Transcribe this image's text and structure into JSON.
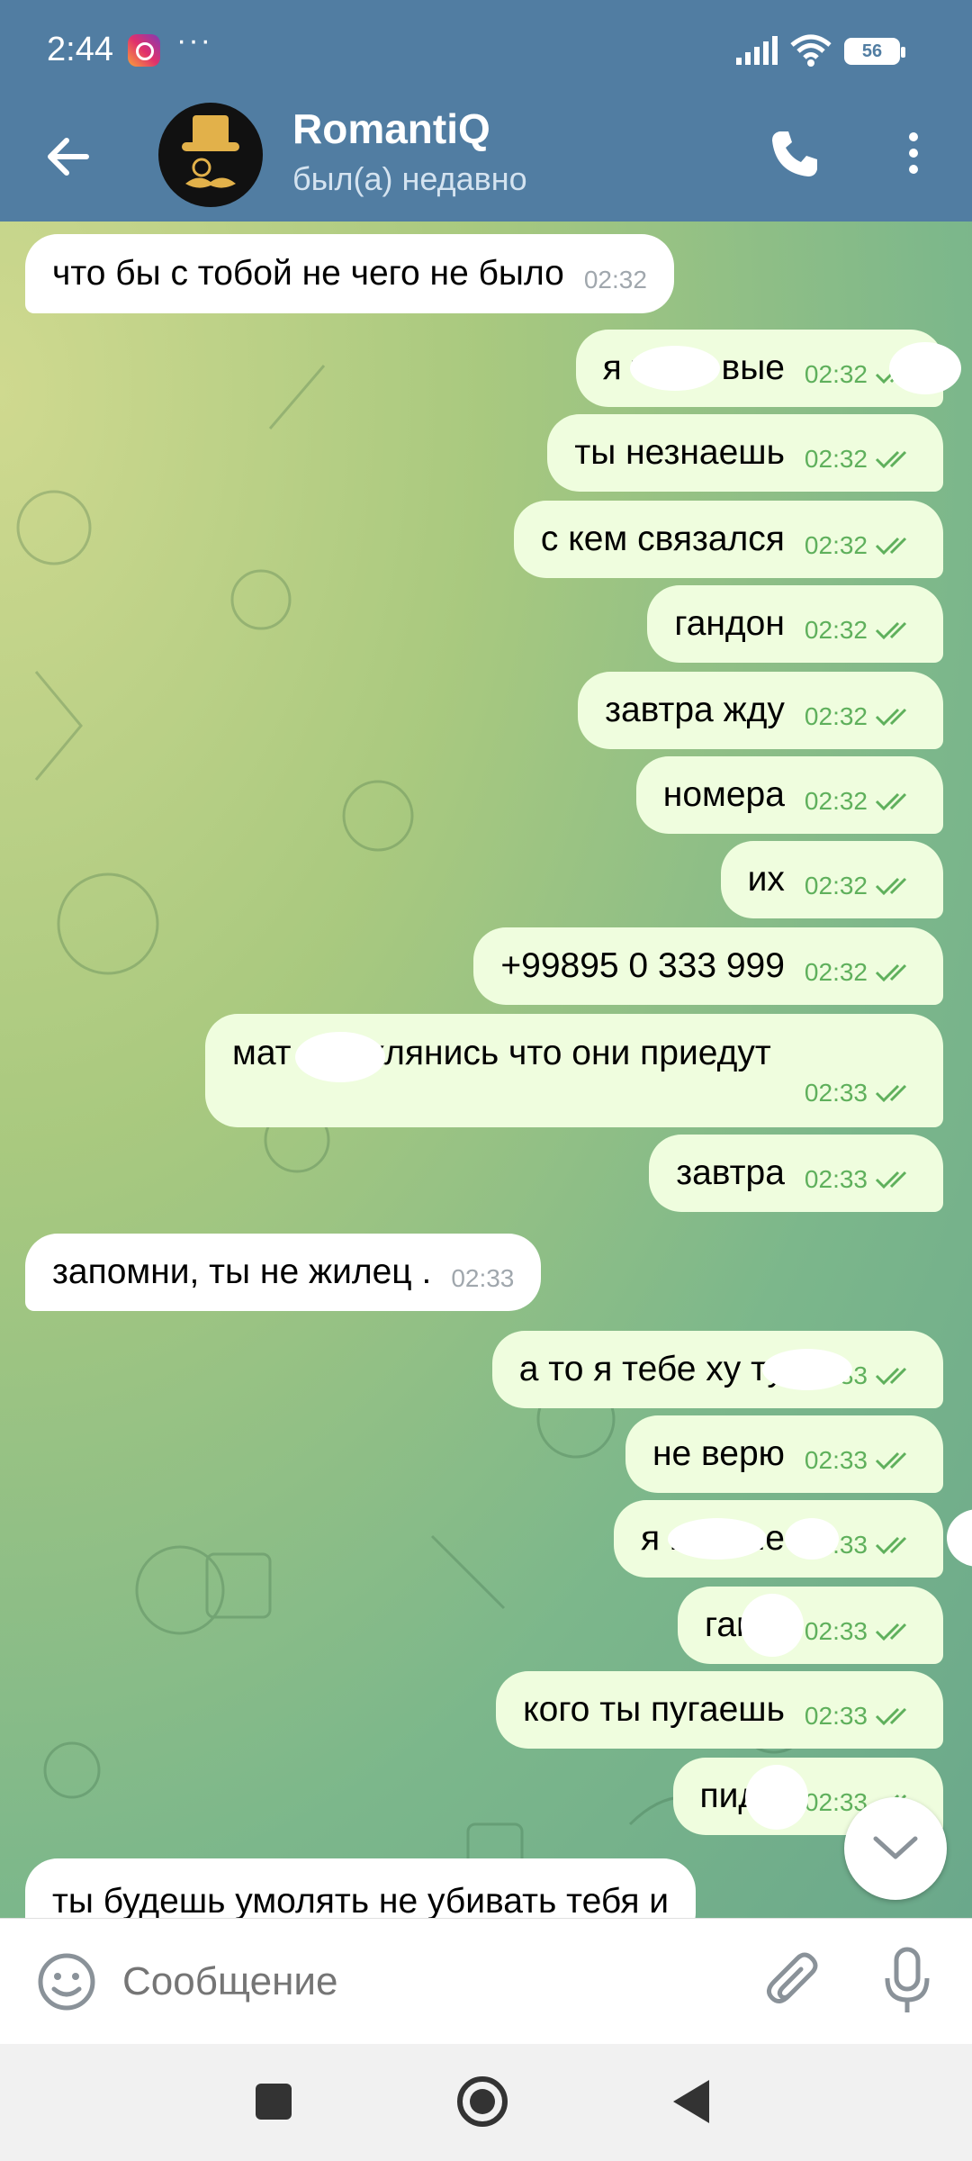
{
  "status_bar": {
    "time": "2:44",
    "dots": "···",
    "battery": "56"
  },
  "header": {
    "title": "RomantiQ",
    "subtitle": "был(а) недавно"
  },
  "messages": [
    {
      "dir": "in",
      "text": "что бы с тобой не чего не было",
      "time": "02:32"
    },
    {
      "dir": "out",
      "text": "я        твою вые",
      "time": "02:32"
    },
    {
      "dir": "out",
      "text": "ты незнаешь",
      "time": "02:32"
    },
    {
      "dir": "out",
      "text": "с кем связался",
      "time": "02:32"
    },
    {
      "dir": "out",
      "text": "гандон",
      "time": "02:32"
    },
    {
      "dir": "out",
      "text": "завтра жду",
      "time": "02:32"
    },
    {
      "dir": "out",
      "text": "номера",
      "time": "02:32"
    },
    {
      "dir": "out",
      "text": "их",
      "time": "02:32"
    },
    {
      "dir": "out",
      "text": "+99895 0 333 999",
      "time": "02:32"
    },
    {
      "dir": "out",
      "text": "мат    о поклянись что они приедут",
      "time": "02:33"
    },
    {
      "dir": "out",
      "text": "завтра",
      "time": "02:33"
    },
    {
      "dir": "in",
      "text": "запомни, ты не жилец .",
      "time": "02:33"
    },
    {
      "dir": "out",
      "text": "а то я тебе ху        ту",
      "time": "02:33"
    },
    {
      "dir": "out",
      "text": "не верю",
      "time": "02:33"
    },
    {
      "dir": "out",
      "text": "я            му вые",
      "time": "02:33"
    },
    {
      "dir": "out",
      "text": "ган    н",
      "time": "02:33"
    },
    {
      "dir": "out",
      "text": "кого ты пугаешь",
      "time": "02:33"
    },
    {
      "dir": "out",
      "text": "пид    з",
      "time": "02:33"
    },
    {
      "dir": "in",
      "text": "ты будешь умолять не убивать тебя и",
      "time": ""
    }
  ],
  "input": {
    "placeholder": "Сообщение"
  },
  "colors": {
    "header": "#517da2",
    "bubble_in": "#ffffff",
    "bubble_out": "#effdde",
    "meta_out": "#5fb05c"
  },
  "icons": [
    "back-arrow-icon",
    "phone-icon",
    "more-vert-icon",
    "emoji-icon",
    "attach-icon",
    "mic-icon",
    "chevron-down-icon"
  ]
}
